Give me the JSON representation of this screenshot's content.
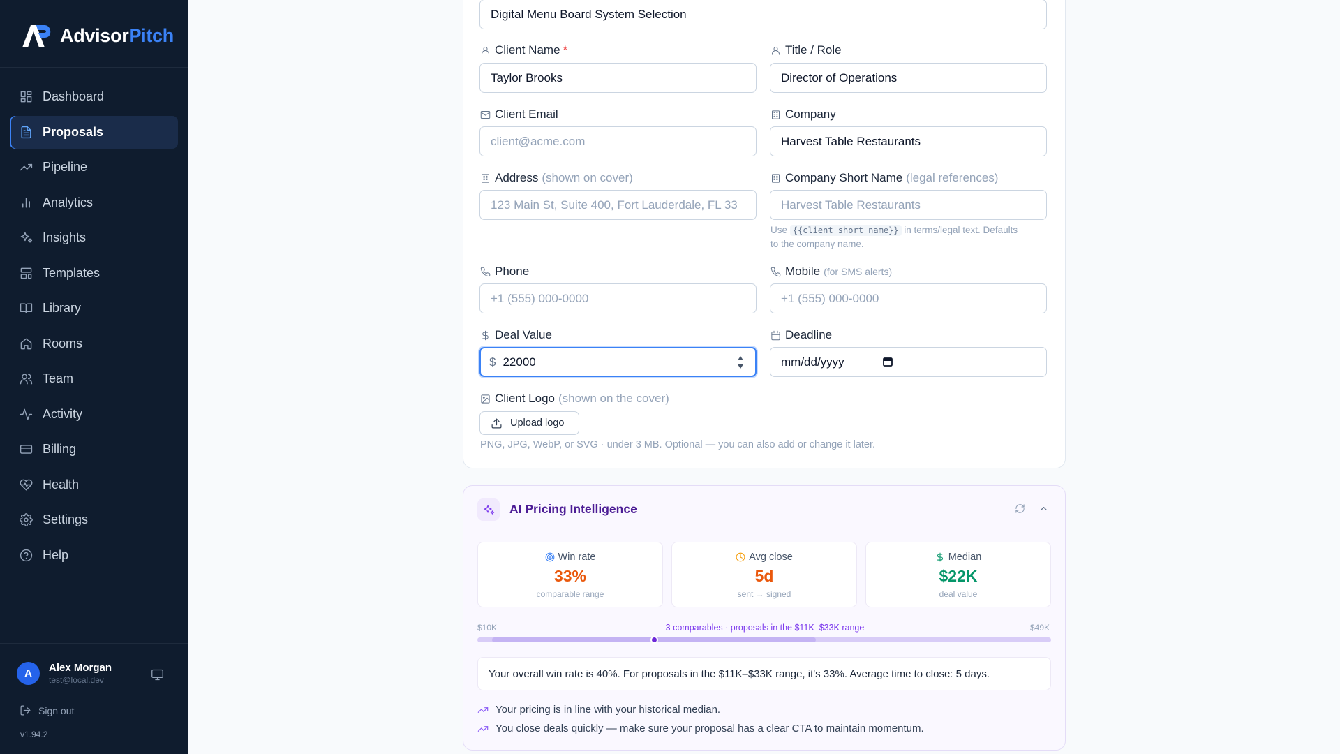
{
  "brand": {
    "name_part1": "Advisor",
    "name_part2": "Pitch"
  },
  "sidebar": {
    "items": [
      {
        "label": "Dashboard",
        "icon": "dashboard-icon"
      },
      {
        "label": "Proposals",
        "icon": "document-icon",
        "active": true
      },
      {
        "label": "Pipeline",
        "icon": "trending-icon"
      },
      {
        "label": "Analytics",
        "icon": "bar-chart-icon"
      },
      {
        "label": "Insights",
        "icon": "sparkles-icon"
      },
      {
        "label": "Templates",
        "icon": "templates-icon"
      },
      {
        "label": "Library",
        "icon": "book-icon"
      },
      {
        "label": "Rooms",
        "icon": "home-icon"
      },
      {
        "label": "Team",
        "icon": "users-icon"
      },
      {
        "label": "Activity",
        "icon": "activity-icon"
      },
      {
        "label": "Billing",
        "icon": "credit-card-icon"
      },
      {
        "label": "Health",
        "icon": "heart-pulse-icon"
      },
      {
        "label": "Settings",
        "icon": "gear-icon"
      },
      {
        "label": "Help",
        "icon": "help-icon"
      }
    ],
    "user": {
      "initial": "A",
      "name": "Alex Morgan",
      "email": "test@local.dev"
    },
    "signout_label": "Sign out",
    "version": "v1.94.2"
  },
  "form": {
    "title_value": "Digital Menu Board System Selection",
    "client_name": {
      "label": "Client Name",
      "required_mark": "*",
      "value": "Taylor Brooks"
    },
    "title_role": {
      "label": "Title / Role",
      "value": "Director of Operations"
    },
    "client_email": {
      "label": "Client Email",
      "placeholder": "client@acme.com"
    },
    "company": {
      "label": "Company",
      "value": "Harvest Table Restaurants"
    },
    "address": {
      "label": "Address",
      "hint": "(shown on cover)",
      "placeholder": "123 Main St, Suite 400, Fort Lauderdale, FL 33"
    },
    "company_short": {
      "label": "Company Short Name",
      "hint": "(legal references)",
      "placeholder": "Harvest Table Restaurants",
      "helper_pre": "Use",
      "helper_code": "{{client_short_name}}",
      "helper_post": "in terms/legal text. Defaults",
      "helper_line2": "to the company name."
    },
    "phone": {
      "label": "Phone",
      "placeholder": "+1 (555) 000-0000"
    },
    "mobile": {
      "label": "Mobile",
      "hint": "(for SMS alerts)",
      "placeholder": "+1 (555) 000-0000"
    },
    "deal_value": {
      "label": "Deal Value",
      "currency": "$",
      "value": "22000"
    },
    "deadline": {
      "label": "Deadline",
      "placeholder": "mm/dd/yyyy"
    },
    "client_logo": {
      "label": "Client Logo",
      "hint": "(shown on the cover)",
      "button": "Upload logo",
      "helper": "PNG, JPG, WebP, or SVG · under 3 MB. Optional — you can also add or change it later."
    }
  },
  "ai_pricing": {
    "title": "AI Pricing Intelligence",
    "stats": [
      {
        "label": "Win rate",
        "value": "33%",
        "sub": "comparable range",
        "color": "#ea580c",
        "icon": "target-icon"
      },
      {
        "label": "Avg close",
        "value": "5d",
        "sub": "sent → signed",
        "color": "#ea580c",
        "icon": "clock-icon"
      },
      {
        "label": "Median",
        "value": "$22K",
        "sub": "deal value",
        "color": "#059669",
        "icon": "dollar-icon"
      }
    ],
    "range": {
      "min_label": "$10K",
      "max_label": "$49K",
      "note": "3 comparables · proposals in the $11K–$33K range",
      "min": 10000,
      "max": 49000,
      "band_low": 11000,
      "band_high": 33000,
      "marker": 22000
    },
    "summary": "Your overall win rate is 40%. For proposals in the $11K–$33K range, it's 33%. Average time to close: 5 days.",
    "insights": [
      "Your pricing is in line with your historical median.",
      "You close deals quickly — make sure your proposal has a clear CTA to maintain momentum."
    ]
  },
  "colors": {
    "sidebar_bg": "#0f1c2e",
    "brand_accent": "#3b82f6",
    "ai_accent": "#7c3aed"
  }
}
